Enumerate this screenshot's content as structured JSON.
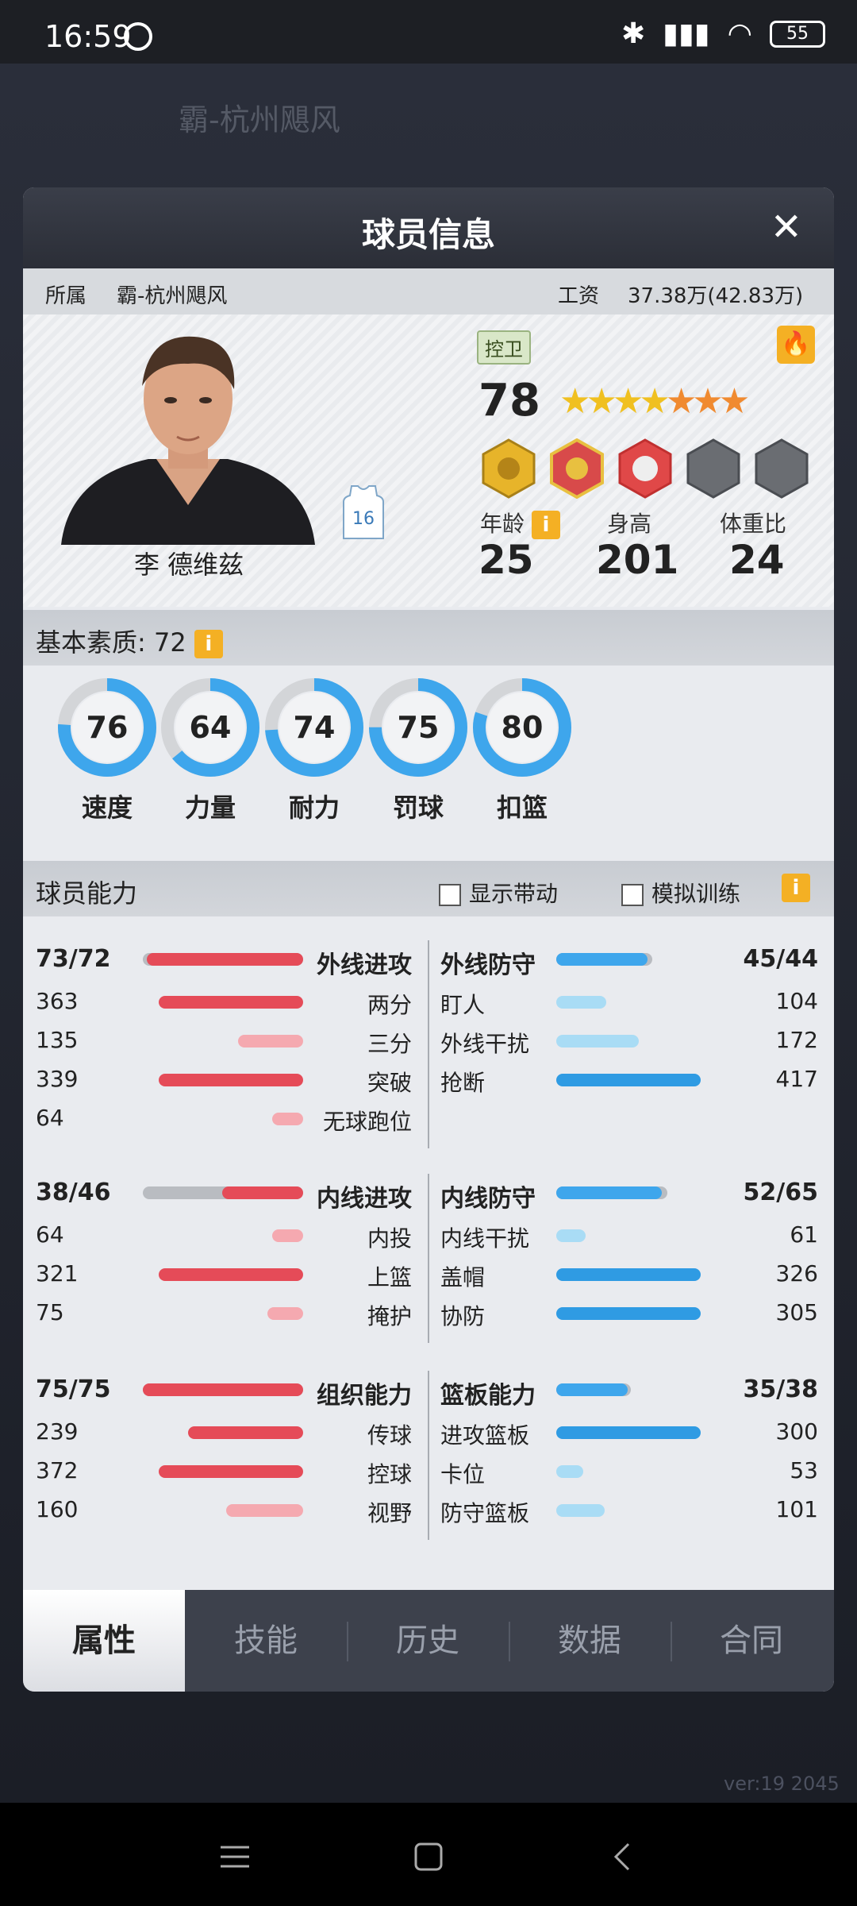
{
  "status_bar": {
    "time": "16:59",
    "battery": "55"
  },
  "background": {
    "team_name": "霸-杭州飓风",
    "version": "ver:19 2045"
  },
  "modal": {
    "title": "球员信息",
    "close": "✕"
  },
  "team_info": {
    "team_label": "所属",
    "team_name": "霸-杭州飓风",
    "salary_label": "工资",
    "salary_value": "37.38万(42.83万)"
  },
  "player": {
    "name": "李 德维兹",
    "jersey_number": "16",
    "position": "控卫",
    "overall": "78",
    "stars": "★★★★★★★",
    "age_label": "年龄",
    "age": "25",
    "height_label": "身高",
    "height": "201",
    "weight_label": "体重比",
    "weight": "24",
    "info_icon": "i"
  },
  "basic": {
    "label": "基本素质: 72",
    "info_icon": "i",
    "items": [
      {
        "label": "速度",
        "value": "76"
      },
      {
        "label": "力量",
        "value": "64"
      },
      {
        "label": "耐力",
        "value": "74"
      },
      {
        "label": "罚球",
        "value": "75"
      },
      {
        "label": "扣篮",
        "value": "80"
      }
    ]
  },
  "ability": {
    "label": "球员能力",
    "show_label": "显示带动",
    "sim_label": "模拟训练",
    "info_icon": "i",
    "groups": [
      {
        "left": {
          "label": "外线进攻",
          "value": "73/72",
          "items": [
            {
              "label": "两分",
              "value": "363"
            },
            {
              "label": "三分",
              "value": "135"
            },
            {
              "label": "突破",
              "value": "339"
            },
            {
              "label": "无球跑位",
              "value": "64"
            }
          ]
        },
        "right": {
          "label": "外线防守",
          "value": "45/44",
          "items": [
            {
              "label": "盯人",
              "value": "104"
            },
            {
              "label": "外线干扰",
              "value": "172"
            },
            {
              "label": "抢断",
              "value": "417"
            }
          ]
        }
      },
      {
        "left": {
          "label": "内线进攻",
          "value": "38/46",
          "items": [
            {
              "label": "内投",
              "value": "64"
            },
            {
              "label": "上篮",
              "value": "321"
            },
            {
              "label": "掩护",
              "value": "75"
            }
          ]
        },
        "right": {
          "label": "内线防守",
          "value": "52/65",
          "items": [
            {
              "label": "内线干扰",
              "value": "61"
            },
            {
              "label": "盖帽",
              "value": "326"
            },
            {
              "label": "协防",
              "value": "305"
            }
          ]
        }
      },
      {
        "left": {
          "label": "组织能力",
          "value": "75/75",
          "items": [
            {
              "label": "传球",
              "value": "239"
            },
            {
              "label": "控球",
              "value": "372"
            },
            {
              "label": "视野",
              "value": "160"
            }
          ]
        },
        "right": {
          "label": "篮板能力",
          "value": "35/38",
          "items": [
            {
              "label": "进攻篮板",
              "value": "300"
            },
            {
              "label": "卡位",
              "value": "53"
            },
            {
              "label": "防守篮板",
              "value": "101"
            }
          ]
        }
      }
    ]
  },
  "tabs": [
    "属性",
    "技能",
    "历史",
    "数据",
    "合同"
  ],
  "colors": {
    "ring": "#3ea6ec",
    "bar_red": "#e54b58",
    "bar_red_light": "#f5a9b0",
    "bar_blue": "#2f9be3",
    "bar_blue_light": "#a9dcf5",
    "accent": "#f4b024"
  }
}
